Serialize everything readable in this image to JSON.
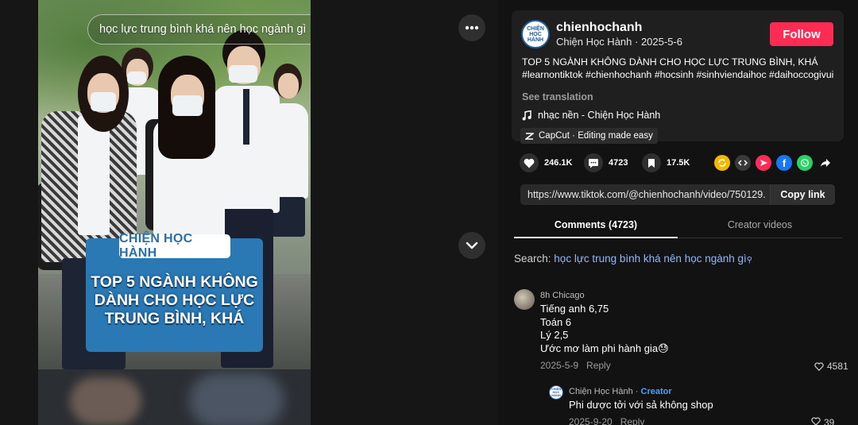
{
  "video": {
    "search_query": "học lực trung bình khá nên học ngành gì",
    "overlay_label": "CHIỆN HỌC HÀNH",
    "overlay_title": "TOP 5 NGÀNH KHÔNG DÀNH CHO HỌC LỰC TRUNG BÌNH, KHÁ"
  },
  "author": {
    "avatar_text": "CHIỆN HỌC HÀNH",
    "username": "chienhochanh",
    "display_name_date": "Chiện Học Hành · 2025-5-6",
    "follow_label": "Follow"
  },
  "post": {
    "caption": "TOP 5 NGÀNH KHÔNG DÀNH CHO HỌC LỰC TRUNG BÌNH, KHÁ",
    "hashtags": "#learnontiktok #chienhochanh #hocsinh #sinhviendaihoc #daihoccogivui",
    "see_translation": "See translation",
    "music": "nhạc nền - Chiện Học Hành",
    "capcut": "CapCut · Editing made easy"
  },
  "stats": {
    "likes": "246.1K",
    "comments": "4723",
    "saves": "17.5K"
  },
  "link": {
    "url": "https://www.tiktok.com/@chienhochanh/video/750129...",
    "copy_label": "Copy link"
  },
  "tabs": {
    "comments": "Comments (4723)",
    "creator_videos": "Creator videos"
  },
  "search": {
    "prefix": "Search:",
    "keyword": "học lực trung bình khá nên học ngành gì"
  },
  "comment": {
    "user": "8h Chicago",
    "lines": [
      "Tiếng anh 6,75",
      "Toán 6",
      "Lý 2,5",
      "Ước mơ làm phi hành gia😓"
    ],
    "date": "2025-5-9",
    "reply_label": "Reply",
    "likes": "4581"
  },
  "reply": {
    "user": "Chiện Học Hành",
    "creator_badge": "Creator",
    "text": "Phi dược tởi với sả không shop",
    "date": "2025-9-20",
    "reply_label": "Reply",
    "likes": "39"
  },
  "colors": {
    "accent": "#fe2c55",
    "link_blue": "#8fb8ff",
    "creator_blue": "#4d9fff"
  }
}
